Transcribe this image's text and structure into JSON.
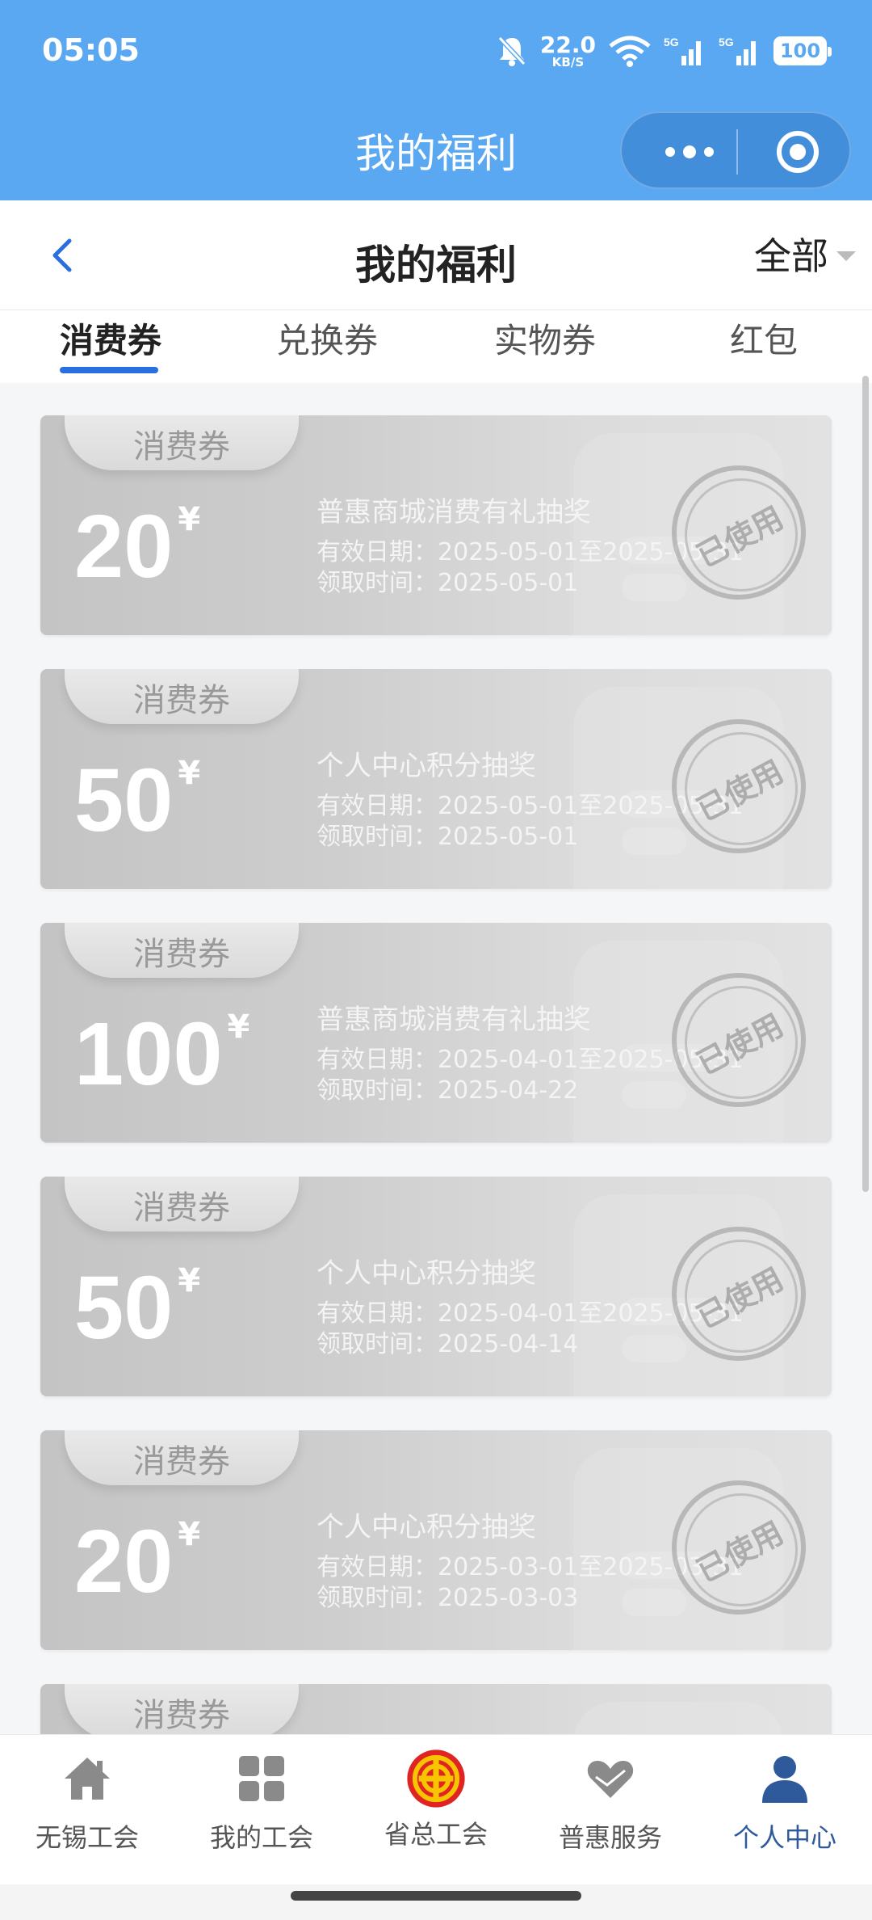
{
  "status_bar": {
    "time": "05:05",
    "net_speed_value": "22.0",
    "net_speed_unit": "KB/S",
    "signal1": "5G",
    "signal2": "5G",
    "battery": "100"
  },
  "mini_program": {
    "title": "我的福利"
  },
  "header": {
    "title": "我的福利",
    "filter_label": "全部"
  },
  "tabs": [
    {
      "label": "消费券",
      "active": true
    },
    {
      "label": "兑换券",
      "active": false
    },
    {
      "label": "实物券",
      "active": false
    },
    {
      "label": "红包",
      "active": false
    }
  ],
  "coupons": [
    {
      "tag": "消费券",
      "amount": "20",
      "unit": "¥",
      "name": "普惠商城消费有礼抽奖",
      "valid_label": "有效日期：",
      "valid": "2025-05-01至2025-05-31",
      "received_label": "领取时间：",
      "received": "2025-05-01",
      "stamp": "已使用"
    },
    {
      "tag": "消费券",
      "amount": "50",
      "unit": "¥",
      "name": "个人中心积分抽奖",
      "valid_label": "有效日期：",
      "valid": "2025-05-01至2025-05-31",
      "received_label": "领取时间：",
      "received": "2025-05-01",
      "stamp": "已使用"
    },
    {
      "tag": "消费券",
      "amount": "100",
      "unit": "¥",
      "name": "普惠商城消费有礼抽奖",
      "valid_label": "有效日期：",
      "valid": "2025-04-01至2025-05-31",
      "received_label": "领取时间：",
      "received": "2025-04-22",
      "stamp": "已使用"
    },
    {
      "tag": "消费券",
      "amount": "50",
      "unit": "¥",
      "name": "个人中心积分抽奖",
      "valid_label": "有效日期：",
      "valid": "2025-04-01至2025-05-31",
      "received_label": "领取时间：",
      "received": "2025-04-14",
      "stamp": "已使用"
    },
    {
      "tag": "消费券",
      "amount": "20",
      "unit": "¥",
      "name": "个人中心积分抽奖",
      "valid_label": "有效日期：",
      "valid": "2025-03-01至2025-03-31",
      "received_label": "领取时间：",
      "received": "2025-03-03",
      "stamp": "已使用"
    },
    {
      "tag": "消费券"
    }
  ],
  "tabbar": [
    {
      "label": "无锡工会",
      "icon": "home-icon"
    },
    {
      "label": "我的工会",
      "icon": "grid-icon"
    },
    {
      "label": "省总工会",
      "icon": "union-emblem-icon"
    },
    {
      "label": "普惠服务",
      "icon": "heart-hands-icon"
    },
    {
      "label": "个人中心",
      "icon": "person-icon",
      "active": true
    }
  ],
  "colors": {
    "header_blue": "#5aa8f2",
    "tab_indicator": "#2a6fe0",
    "active_tab_label": "#2e5a9c"
  }
}
